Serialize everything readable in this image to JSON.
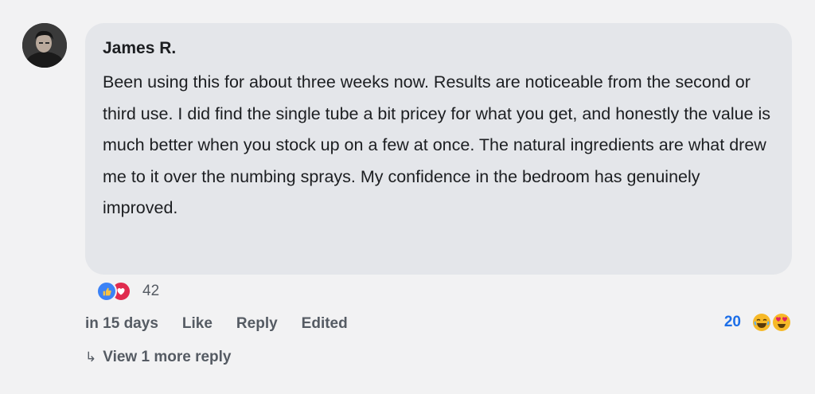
{
  "comment": {
    "author": "James R.",
    "text": "Been using this for about three weeks now. Results are noticeable from the second or third use. I did find the single tube a bit pricey for what you get, and honestly the value is much better when you stock up on a few at once. The natural ingredients are what drew me to it over the numbing sprays. My confidence in the bedroom has genuinely improved.",
    "avatar_icon": "user-avatar-photo"
  },
  "reactions": {
    "icons": [
      "thumbs-up-icon",
      "heart-icon"
    ],
    "count": "42"
  },
  "actions": {
    "time": "in 15 days",
    "like": "Like",
    "reply": "Reply",
    "edited": "Edited"
  },
  "emoji_reactions": {
    "count": "20",
    "icons": [
      "laughing-emoji-icon",
      "heart-eyes-emoji-icon"
    ]
  },
  "view_more": {
    "arrow": "↳",
    "label": "View 1 more reply"
  },
  "colors": {
    "bubble": "#e4e6ea",
    "like_blue": "#3b82f6",
    "love_red": "#e02b4e",
    "count_blue": "#1d6fe8"
  }
}
